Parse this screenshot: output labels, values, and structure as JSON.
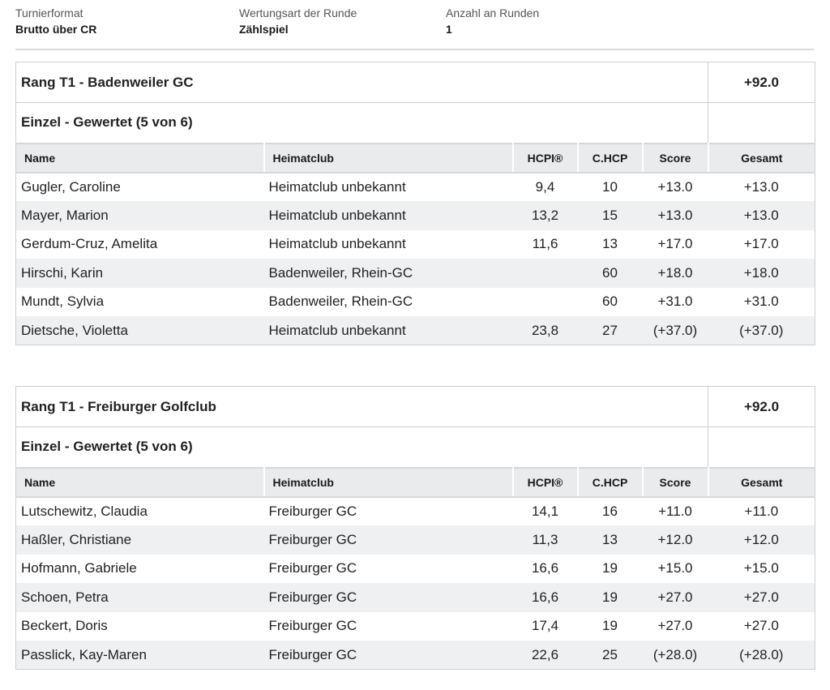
{
  "meta": {
    "format_label": "Turnierformat",
    "format_value": "Brutto über CR",
    "scoring_label": "Wertungsart der Runde",
    "scoring_value": "Zählspiel",
    "rounds_label": "Anzahl an Runden",
    "rounds_value": "1"
  },
  "columns": {
    "name": "Name",
    "club": "Heimatclub",
    "hcpi": "HCPI®",
    "chcp": "C.HCP",
    "score": "Score",
    "total": "Gesamt"
  },
  "teams": [
    {
      "rank_title": "Rang T1 - Badenweiler GC",
      "team_total": "+92.0",
      "einzel_label": "Einzel - Gewertet (5 von 6)",
      "players": [
        {
          "name": "Gugler, Caroline",
          "club": "Heimatclub unbekannt",
          "hcpi": "9,4",
          "chcp": "10",
          "score": "+13.0",
          "total": "+13.0"
        },
        {
          "name": "Mayer, Marion",
          "club": "Heimatclub unbekannt",
          "hcpi": "13,2",
          "chcp": "15",
          "score": "+13.0",
          "total": "+13.0"
        },
        {
          "name": "Gerdum-Cruz, Amelita",
          "club": "Heimatclub unbekannt",
          "hcpi": "11,6",
          "chcp": "13",
          "score": "+17.0",
          "total": "+17.0"
        },
        {
          "name": "Hirschi, Karin",
          "club": "Badenweiler, Rhein-GC",
          "hcpi": "",
          "chcp": "60",
          "score": "+18.0",
          "total": "+18.0"
        },
        {
          "name": "Mundt, Sylvia",
          "club": "Badenweiler, Rhein-GC",
          "hcpi": "",
          "chcp": "60",
          "score": "+31.0",
          "total": "+31.0"
        },
        {
          "name": "Dietsche, Violetta",
          "club": "Heimatclub unbekannt",
          "hcpi": "23,8",
          "chcp": "27",
          "score": "(+37.0)",
          "total": "(+37.0)"
        }
      ]
    },
    {
      "rank_title": "Rang T1 - Freiburger Golfclub",
      "team_total": "+92.0",
      "einzel_label": "Einzel - Gewertet (5 von 6)",
      "players": [
        {
          "name": "Lutschewitz, Claudia",
          "club": "Freiburger GC",
          "hcpi": "14,1",
          "chcp": "16",
          "score": "+11.0",
          "total": "+11.0"
        },
        {
          "name": "Haßler, Christiane",
          "club": "Freiburger GC",
          "hcpi": "11,3",
          "chcp": "13",
          "score": "+12.0",
          "total": "+12.0"
        },
        {
          "name": "Hofmann, Gabriele",
          "club": "Freiburger GC",
          "hcpi": "16,6",
          "chcp": "19",
          "score": "+15.0",
          "total": "+15.0"
        },
        {
          "name": "Schoen, Petra",
          "club": "Freiburger GC",
          "hcpi": "16,6",
          "chcp": "19",
          "score": "+27.0",
          "total": "+27.0"
        },
        {
          "name": "Beckert, Doris",
          "club": "Freiburger GC",
          "hcpi": "17,4",
          "chcp": "19",
          "score": "+27.0",
          "total": "+27.0"
        },
        {
          "name": "Passlick, Kay-Maren",
          "club": "Freiburger GC",
          "hcpi": "22,6",
          "chcp": "25",
          "score": "(+28.0)",
          "total": "(+28.0)"
        }
      ]
    }
  ]
}
